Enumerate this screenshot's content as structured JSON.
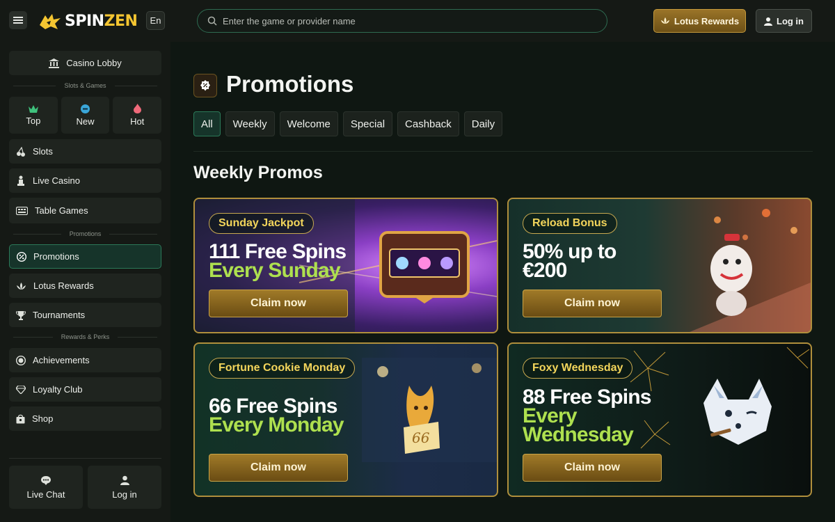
{
  "header": {
    "logo_main": "SPIN",
    "logo_accent": "ZEN",
    "lang": "En",
    "search_placeholder": "Enter the game or provider name",
    "rewards_label": "Lotus Rewards",
    "login_label": "Log in"
  },
  "sidebar": {
    "lobby": "Casino Lobby",
    "section_games": "Slots & Games",
    "quick": [
      {
        "label": "Top",
        "icon": "crown-icon"
      },
      {
        "label": "New",
        "icon": "new-badge-icon"
      },
      {
        "label": "Hot",
        "icon": "flame-icon"
      }
    ],
    "games": [
      {
        "label": "Slots",
        "icon": "cherries-icon"
      },
      {
        "label": "Live Casino",
        "icon": "dealer-icon"
      },
      {
        "label": "Table Games",
        "icon": "cards-table-icon"
      }
    ],
    "section_promos": "Promotions",
    "promos": [
      {
        "label": "Promotions",
        "icon": "promo-icon"
      },
      {
        "label": "Lotus Rewards",
        "icon": "lotus-icon"
      },
      {
        "label": "Tournaments",
        "icon": "trophy-icon"
      }
    ],
    "section_rewards": "Rewards & Perks",
    "rewards": [
      {
        "label": "Achievements",
        "icon": "medal-icon"
      },
      {
        "label": "Loyalty Club",
        "icon": "diamond-icon"
      },
      {
        "label": "Shop",
        "icon": "shop-icon"
      }
    ],
    "bottom": [
      {
        "label": "Live Chat",
        "icon": "chat-icon"
      },
      {
        "label": "Log in",
        "icon": "user-icon"
      }
    ]
  },
  "main": {
    "title": "Promotions",
    "tabs": [
      "All",
      "Weekly",
      "Welcome",
      "Special",
      "Cashback",
      "Daily"
    ],
    "active_tab": "All",
    "section_title": "Weekly Promos",
    "cards": [
      {
        "badge": "Sunday Jackpot",
        "line1": "111 Free Spins",
        "line2": "Every Sunday",
        "cta": "Claim now"
      },
      {
        "badge": "Reload Bonus",
        "line1": "50% up to",
        "line2": "€200",
        "cta": "Claim now"
      },
      {
        "badge": "Fortune Cookie Monday",
        "line1": "66 Free Spins",
        "line2": "Every Monday",
        "cta": "Claim now",
        "cookie_number": "66"
      },
      {
        "badge": "Foxy Wednesday",
        "line1": "88 Free Spins",
        "line2": "Every",
        "line3": "Wednesday",
        "cta": "Claim now"
      }
    ]
  },
  "colors": {
    "accent_gold": "#f4c531",
    "accent_green": "#2b7a59",
    "highlight_lime": "#aee04f"
  }
}
